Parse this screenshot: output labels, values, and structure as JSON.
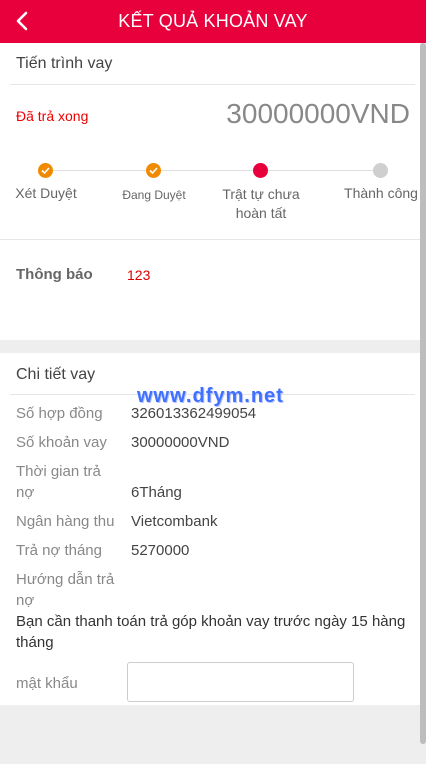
{
  "header": {
    "title": "KẾT QUẢ KHOẢN VAY"
  },
  "progress": {
    "section_title": "Tiến trình vay",
    "status": "Đã trả xong",
    "amount": "30000000VND",
    "steps": [
      {
        "label": "Xét Duyệt",
        "state": "done"
      },
      {
        "label": "Đang Duyệt",
        "state": "done"
      },
      {
        "label": "Trật tự chưa hoàn tất",
        "state": "current"
      },
      {
        "label": "Thành công",
        "state": "pending"
      }
    ]
  },
  "notice": {
    "label": "Thông báo",
    "value": "123"
  },
  "details": {
    "section_title": "Chi tiết vay",
    "rows": [
      {
        "label": "Số hợp đồng",
        "value": "326013362499054"
      },
      {
        "label": "Số khoản vay",
        "value": "30000000VND"
      },
      {
        "label": "Thời gian trả nợ",
        "value": "6Tháng"
      },
      {
        "label": "Ngân hàng thu",
        "value": "Vietcombank"
      },
      {
        "label": "Trả nợ tháng",
        "value": "5270000"
      },
      {
        "label": "Hướng dẫn trả nợ",
        "value": ""
      }
    ],
    "instruction": "Bạn cần thanh toán trả góp khoản vay trước ngày 15 hàng tháng",
    "password_label": "mật khẩu",
    "password_value": ""
  },
  "watermark": "www.dfym.net",
  "colors": {
    "primary": "#e8003c",
    "done_step": "#f08a00",
    "pending_step": "#cfcfcf",
    "status_text": "#ee0000"
  }
}
